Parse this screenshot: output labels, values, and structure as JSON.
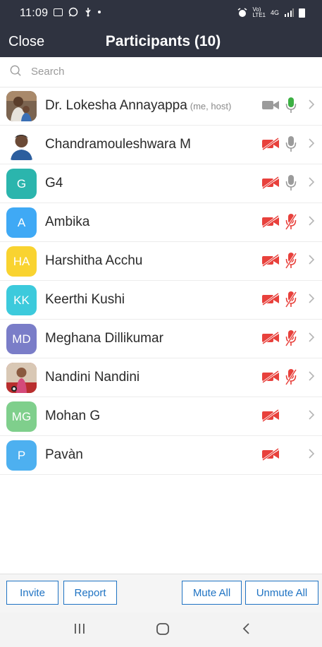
{
  "status_bar": {
    "time": "11:09",
    "network_label": "4G"
  },
  "header": {
    "close_label": "Close",
    "title": "Participants (10)"
  },
  "search": {
    "placeholder": "Search"
  },
  "participants": [
    {
      "name": "Dr. Lokesha Annayappa",
      "tag": "(me, host)",
      "initials": "",
      "avatar_color": "#7b6450",
      "avatar_type": "photo-man-child",
      "video": "on",
      "audio": "on",
      "audio_state_color": "#3cb043"
    },
    {
      "name": "Chandramouleshwara M",
      "tag": "",
      "initials": "",
      "avatar_color": "#ffffff",
      "avatar_type": "photo-man",
      "video": "off",
      "audio": "available"
    },
    {
      "name": "G4",
      "tag": "",
      "initials": "G",
      "avatar_color": "#2bb5ad",
      "avatar_type": "initials",
      "video": "off",
      "audio": "available"
    },
    {
      "name": "Ambika",
      "tag": "",
      "initials": "A",
      "avatar_color": "#3fa9f5",
      "avatar_type": "initials",
      "video": "off",
      "audio": "muted"
    },
    {
      "name": "Harshitha Acchu",
      "tag": "",
      "initials": "HA",
      "avatar_color": "#f9d330",
      "avatar_type": "initials",
      "video": "off",
      "audio": "muted"
    },
    {
      "name": "Keerthi Kushi",
      "tag": "",
      "initials": "KK",
      "avatar_color": "#3ccadc",
      "avatar_type": "initials",
      "video": "off",
      "audio": "muted"
    },
    {
      "name": "Meghana Dillikumar",
      "tag": "",
      "initials": "MD",
      "avatar_color": "#7a7dc8",
      "avatar_type": "initials",
      "video": "off",
      "audio": "muted"
    },
    {
      "name": "Nandini Nandini",
      "tag": "",
      "initials": "",
      "avatar_color": "#b92e2e",
      "avatar_type": "photo-woman",
      "video": "off",
      "audio": "muted"
    },
    {
      "name": "Mohan G",
      "tag": "",
      "initials": "MG",
      "avatar_color": "#7fcf8c",
      "avatar_type": "initials",
      "video": "off",
      "audio": "none"
    },
    {
      "name": "Pavàn",
      "tag": "",
      "initials": "P",
      "avatar_color": "#4db0f0",
      "avatar_type": "initials",
      "video": "off",
      "audio": "none"
    }
  ],
  "footer": {
    "invite_label": "Invite",
    "report_label": "Report",
    "mute_all_label": "Mute All",
    "unmute_all_label": "Unmute All"
  },
  "colors": {
    "header_bg": "#2f3340",
    "accent": "#1f73c3",
    "muted_red": "#e8413c",
    "icon_gray": "#9b9b9b"
  },
  "icons": {
    "search": "search-icon",
    "video_on": "video-camera-icon",
    "video_off": "video-camera-off-icon",
    "mic_on": "microphone-icon",
    "mic_off": "microphone-off-icon",
    "chevron": "chevron-right-icon"
  }
}
